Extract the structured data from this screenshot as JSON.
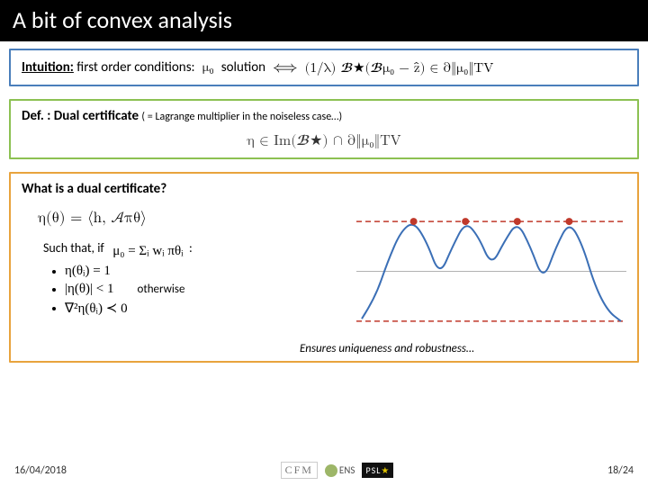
{
  "title": "A bit of convex analysis",
  "row1": {
    "intuition_label": "Intuition:",
    "intuition_text": " first order conditions:",
    "mu0": "μ₀",
    "solution": "solution",
    "iff": "⟺",
    "rhs": "(1/λ) 𝓑★(𝓑μ₀ − ẑ) ∈ ∂‖μ₀‖TV"
  },
  "def": {
    "title": "Def. : Dual certificate ",
    "sub": "( = Lagrange multiplier in the noiseless case…)",
    "math": "η ∈ Im(𝓑★) ∩ ∂‖μ₀‖TV"
  },
  "box3": {
    "q": "What is a dual certificate?",
    "eta": "η(θ) = ⟨h, 𝒜πθ⟩",
    "such": "Such that, if",
    "mu": "μ₀ = Σᵢ wᵢ πθᵢ",
    "colon": ":",
    "b1": "η(θᵢ) = 1",
    "b2_l": "|η(θ)| < 1",
    "b2_r": "otherwise",
    "b3": "∇²η(θᵢ) ≺ 0",
    "ensures": "Ensures uniqueness and robustness…"
  },
  "footer": {
    "date": "16/04/2018",
    "page": "18/24",
    "logos": {
      "cfm": "CFM",
      "ens": "ENS",
      "psl": "PSL",
      "star": "★"
    }
  },
  "chart_data": {
    "type": "line",
    "title": "",
    "xlabel": "",
    "ylabel": "",
    "xlim": [
      0,
      10
    ],
    "ylim": [
      -1.2,
      1.2
    ],
    "x": [
      0,
      0.5,
      1,
      1.5,
      2,
      2.5,
      3,
      3.5,
      4,
      4.5,
      5,
      5.5,
      6,
      6.5,
      7,
      7.5,
      8,
      8.5,
      9,
      9.5,
      10
    ],
    "y": [
      -0.95,
      -0.55,
      0.2,
      0.8,
      1.0,
      0.6,
      -0.1,
      0.5,
      1.0,
      0.7,
      0.1,
      0.6,
      1.0,
      0.5,
      -0.2,
      0.5,
      1.0,
      0.55,
      -0.3,
      -0.8,
      -1.0
    ],
    "peaks_x": [
      2,
      4,
      6,
      8
    ],
    "peaks_y": [
      1,
      1,
      1,
      1
    ],
    "guides": [
      1,
      -1
    ],
    "colors": {
      "curve": "#3b6fb6",
      "peak": "#c0392b",
      "guide": "#c0392b"
    }
  }
}
